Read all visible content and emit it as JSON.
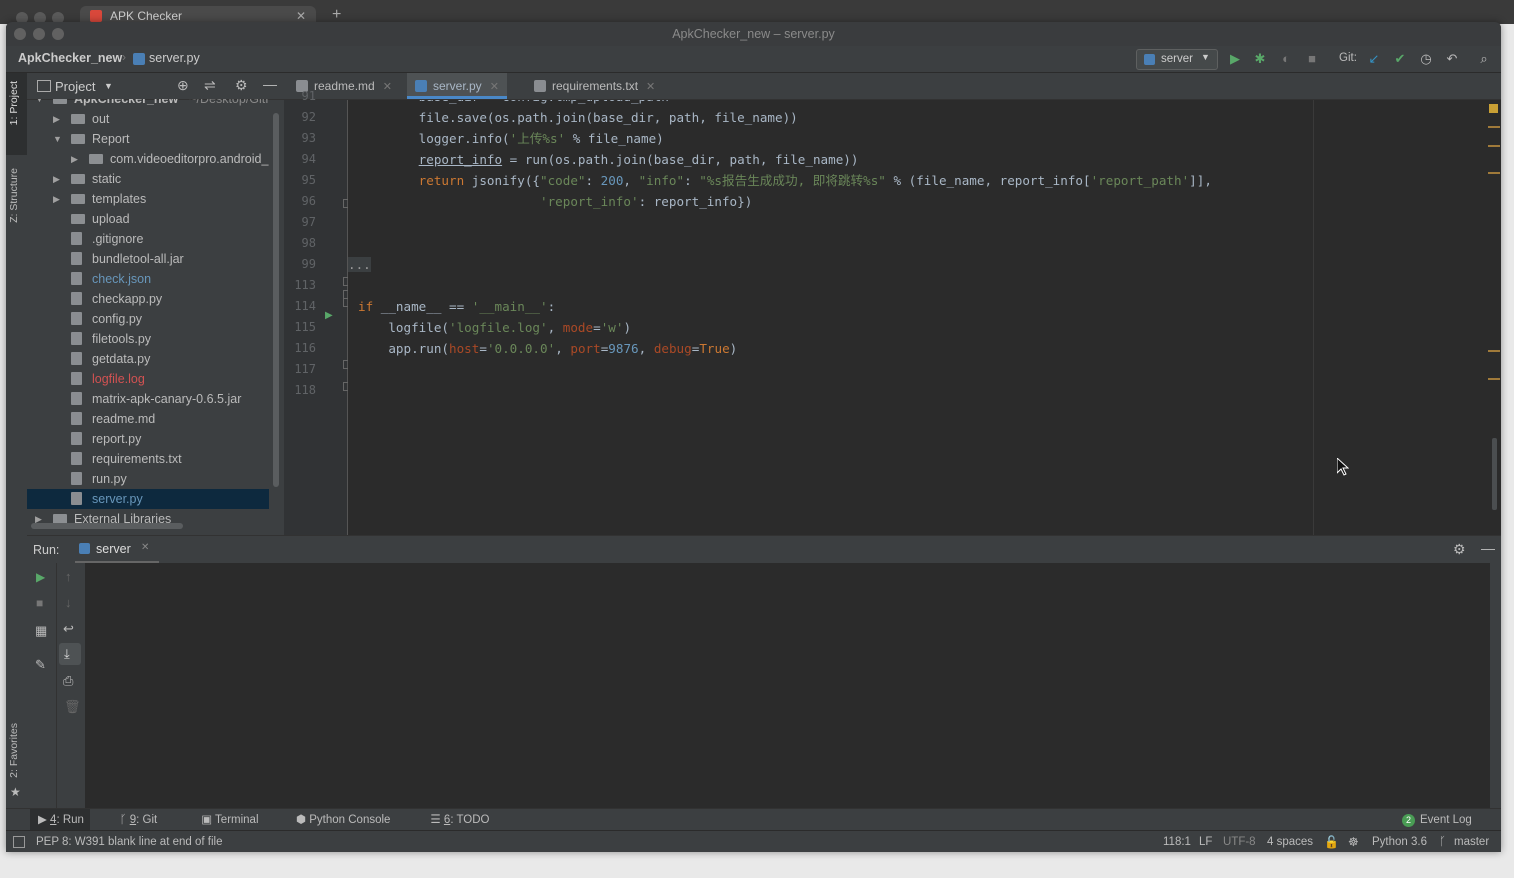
{
  "browser": {
    "tab_title": "APK Checker"
  },
  "window": {
    "title": "ApkChecker_new – server.py"
  },
  "navbar": {
    "breadcrumb_project": "ApkChecker_new",
    "breadcrumb_file": "server.py",
    "run_config": "server",
    "git_label": "Git:"
  },
  "side_tabs": {
    "project": "1: Project",
    "structure": "Z: Structure",
    "favorites": "2: Favorites"
  },
  "project_panel": {
    "title": "Project",
    "tree": [
      {
        "label": "ApkChecker_new",
        "extra": "~/Desktop/GitH",
        "type": "folder",
        "indent": 0,
        "expanded": true
      },
      {
        "label": "out",
        "type": "folder",
        "indent": 1,
        "expanded": false
      },
      {
        "label": "Report",
        "type": "folder",
        "indent": 1,
        "expanded": true
      },
      {
        "label": "com.videoeditorpro.android_i",
        "type": "folder",
        "indent": 2,
        "expanded": false
      },
      {
        "label": "static",
        "type": "folder",
        "indent": 1,
        "expanded": false
      },
      {
        "label": "templates",
        "type": "folder",
        "indent": 1,
        "expanded": false
      },
      {
        "label": "upload",
        "type": "folder",
        "indent": 1
      },
      {
        "label": ".gitignore",
        "type": "file",
        "indent": 1
      },
      {
        "label": "bundletool-all.jar",
        "type": "file",
        "indent": 1
      },
      {
        "label": "check.json",
        "type": "file",
        "indent": 1,
        "color": "#6897bb"
      },
      {
        "label": "checkapp.py",
        "type": "file",
        "indent": 1
      },
      {
        "label": "config.py",
        "type": "file",
        "indent": 1
      },
      {
        "label": "filetools.py",
        "type": "file",
        "indent": 1
      },
      {
        "label": "getdata.py",
        "type": "file",
        "indent": 1
      },
      {
        "label": "logfile.log",
        "type": "file",
        "indent": 1,
        "color": "#d25252"
      },
      {
        "label": "matrix-apk-canary-0.6.5.jar",
        "type": "file",
        "indent": 1
      },
      {
        "label": "readme.md",
        "type": "file",
        "indent": 1
      },
      {
        "label": "report.py",
        "type": "file",
        "indent": 1
      },
      {
        "label": "requirements.txt",
        "type": "file",
        "indent": 1
      },
      {
        "label": "run.py",
        "type": "file",
        "indent": 1
      },
      {
        "label": "server.py",
        "type": "file",
        "indent": 1,
        "selected": true,
        "color": "#6897bb"
      },
      {
        "label": "External Libraries",
        "type": "folder",
        "indent": 0,
        "expanded": false
      }
    ]
  },
  "editor_tabs": [
    {
      "label": "readme.md",
      "active": false
    },
    {
      "label": "server.py",
      "active": true
    },
    {
      "label": "requirements.txt",
      "active": false
    }
  ],
  "code_lines": [
    {
      "n": "91",
      "html": "        base_dir = config.tmp_upload_path"
    },
    {
      "n": "92",
      "html": "        file.save(os.path.join(base_dir, path, file_name))"
    },
    {
      "n": "93",
      "html": "        logger.info(<span class=\"st\">'上传%s'</span> % file_name)"
    },
    {
      "n": "94",
      "html": "        <u>report_info</u> = run(os.path.join(base_dir, path, file_name))"
    },
    {
      "n": "95",
      "html": "        <span class=\"kw\">return</span> jsonify({<span class=\"st\">\"code\"</span>: <span class=\"nu\">200</span>, <span class=\"st\">\"info\"</span>: <span class=\"st\">\"%s报告生成成功, 即将跳转%s\"</span> % (file_name, report_info[<span class=\"st\">'report_path'</span>]],"
    },
    {
      "n": "96",
      "html": "                        <span class=\"st\">'report_info'</span>: report_info})"
    },
    {
      "n": "97",
      "html": ""
    },
    {
      "n": "98",
      "html": ""
    },
    {
      "n": "99",
      "html": "<span style=\"background:#3b3f41;color:#999\">...</span>"
    },
    {
      "n": "113",
      "html": ""
    },
    {
      "n": "114",
      "html": "<span class=\"kw\">if</span> __name__ == <span class=\"st\">'__main__'</span>:"
    },
    {
      "n": "115",
      "html": "    logfile(<span class=\"st\">'logfile.log'</span>, <span class=\"pa\">mode</span>=<span class=\"st\">'w'</span>)"
    },
    {
      "n": "116",
      "html": "    app.run(<span class=\"pa\">host</span>=<span class=\"st\">'0.0.0.0'</span>, <span class=\"pa\">port</span>=<span class=\"nu\">9876</span>, <span class=\"pa\">debug</span>=<span class=\"kw\">True</span>)"
    },
    {
      "n": "117",
      "html": ""
    },
    {
      "n": "118",
      "html": ""
    }
  ],
  "run_panel": {
    "label": "Run:",
    "tab": "server"
  },
  "toolwindow_tabs": [
    {
      "key": "4",
      "label": ": Run",
      "active": true
    },
    {
      "key": "9",
      "label": ": Git",
      "active": false
    },
    {
      "key": "",
      "label": "Terminal",
      "active": false
    },
    {
      "key": "",
      "label": "Python Console",
      "active": false
    },
    {
      "key": "6",
      "label": ": TODO",
      "active": false
    }
  ],
  "event_log": {
    "count": "2",
    "label": "Event Log"
  },
  "status": {
    "message": "PEP 8: W391 blank line at end of file",
    "position": "118:1",
    "line_sep": "LF",
    "encoding": "UTF-8",
    "indent": "4 spaces",
    "interpreter": "Python 3.6",
    "branch": "master"
  }
}
